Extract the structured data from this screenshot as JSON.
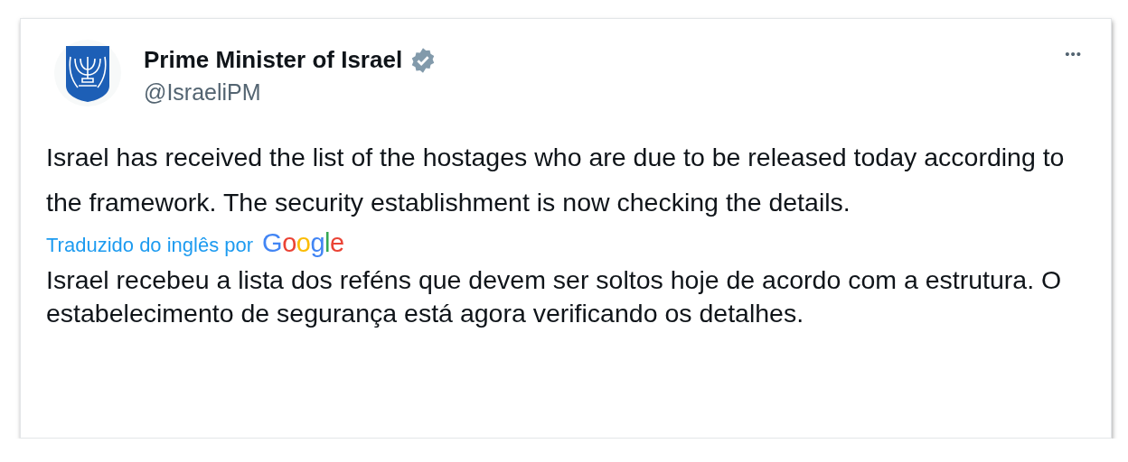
{
  "author": {
    "name": "Prime Minister of Israel",
    "verified": true,
    "handle": "@IsraeliPM"
  },
  "more_button": "•••",
  "text": "Israel has received the list of the hostages who are due to be released today according to the framework. The security establishment is now checking the details.",
  "translation": {
    "label": "Traduzido do inglês por",
    "provider": "Google",
    "text": "Israel recebeu a lista dos reféns que devem ser soltos hoje de acordo com a estrutura. O estabelecimento de segurança está agora verificando os detalhes."
  }
}
